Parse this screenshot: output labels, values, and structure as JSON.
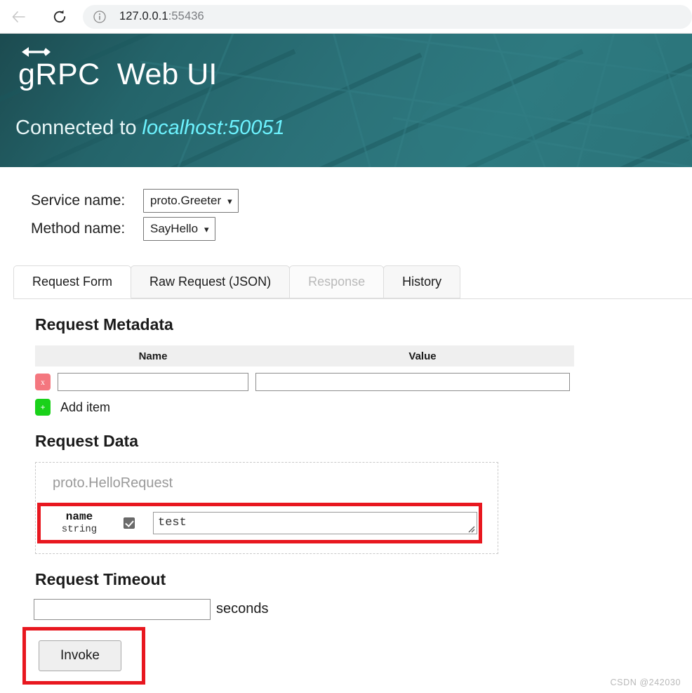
{
  "browser": {
    "back_label": "Back",
    "reload_label": "Reload",
    "site_info_label": "Site information",
    "url_host": "127.0.0.1",
    "url_port": ":55436"
  },
  "header": {
    "brand_grpc": "gRPC",
    "brand_product": "Web UI",
    "connected_prefix": "Connected to",
    "connected_address": "localhost:50051",
    "bg_color": "#2b7379",
    "bg_color_dark": "#1c4b50",
    "address_color": "#6df3ff"
  },
  "selectors": [
    {
      "label": "Service name:",
      "value": "proto.Greeter"
    },
    {
      "label": "Method name:",
      "value": "SayHello"
    }
  ],
  "tabs": [
    {
      "label": "Request Form",
      "state": "active"
    },
    {
      "label": "Raw Request (JSON)",
      "state": "normal"
    },
    {
      "label": "Response",
      "state": "disabled"
    },
    {
      "label": "History",
      "state": "normal"
    }
  ],
  "metadata": {
    "title": "Request Metadata",
    "columns": [
      "Name",
      "Value"
    ],
    "rows": [
      {
        "delete_label": "x",
        "name": "",
        "value": ""
      }
    ],
    "add_item": {
      "icon_label": "+",
      "label": "Add item"
    }
  },
  "request_data": {
    "title": "Request Data",
    "message_type": "proto.HelloRequest",
    "fields": [
      {
        "name": "name",
        "type": "string",
        "enabled": true,
        "value": "test",
        "highlighted": true
      }
    ],
    "highlight_color": "#e8171f"
  },
  "timeout": {
    "title": "Request Timeout",
    "value": "",
    "unit": "seconds"
  },
  "invoke": {
    "label": "Invoke",
    "highlighted": true
  },
  "watermark": "CSDN @242030"
}
